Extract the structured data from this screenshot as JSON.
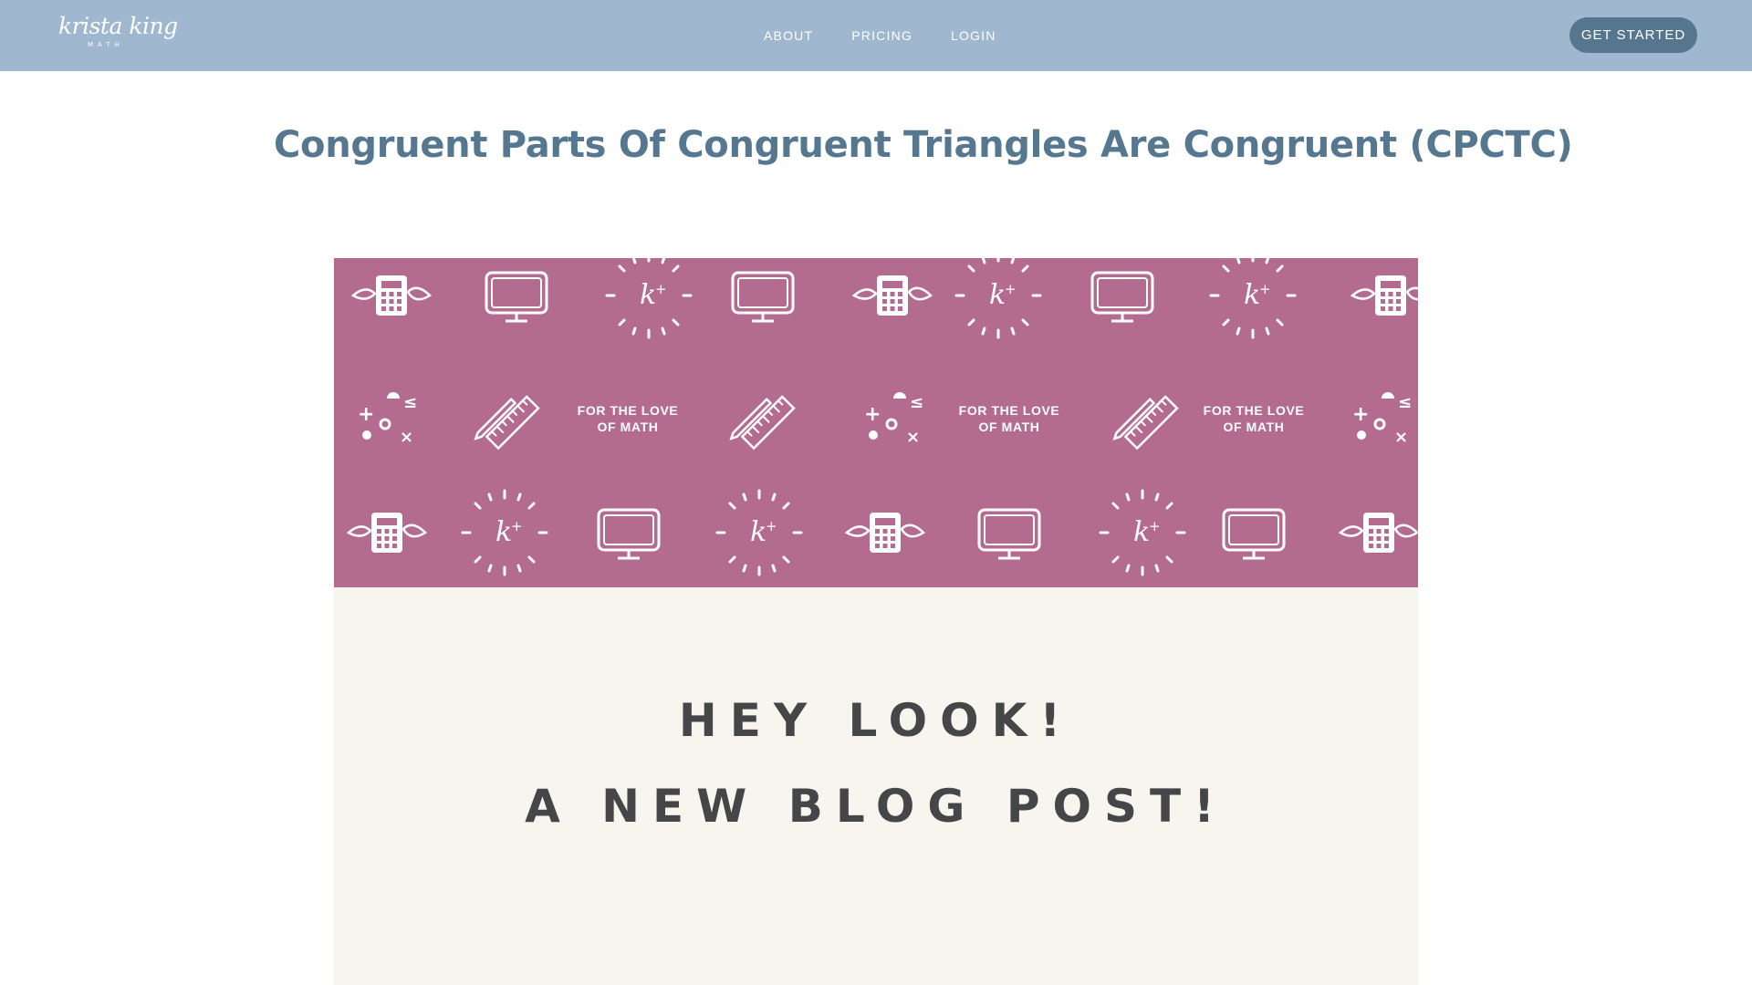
{
  "brand": {
    "logo_script": "krista king",
    "logo_sub": "MATH",
    "header_color": "#9fb7cf"
  },
  "nav": {
    "items": [
      {
        "label": "ABOUT"
      },
      {
        "label": "PRICING"
      },
      {
        "label": "LOGIN"
      }
    ],
    "cta_label": "GET STARTED",
    "cta_color": "#56758f"
  },
  "post": {
    "title": "Congruent Parts Of Congruent Triangles Are Congruent (CPCTC)",
    "title_color": "#55778f"
  },
  "hero": {
    "banner_color": "#b46b90",
    "cream_color": "#f8f4ee",
    "pattern_text": [
      "FOR THE LOVE",
      "OF MATH"
    ],
    "headline_line1": "HEY LOOK!",
    "headline_line2": "A NEW BLOG POST!"
  },
  "icons": [
    "calculator-icon",
    "monitor-icon",
    "k-plus-burst-icon",
    "ruler-pencil-icon",
    "math-symbols-icon"
  ]
}
